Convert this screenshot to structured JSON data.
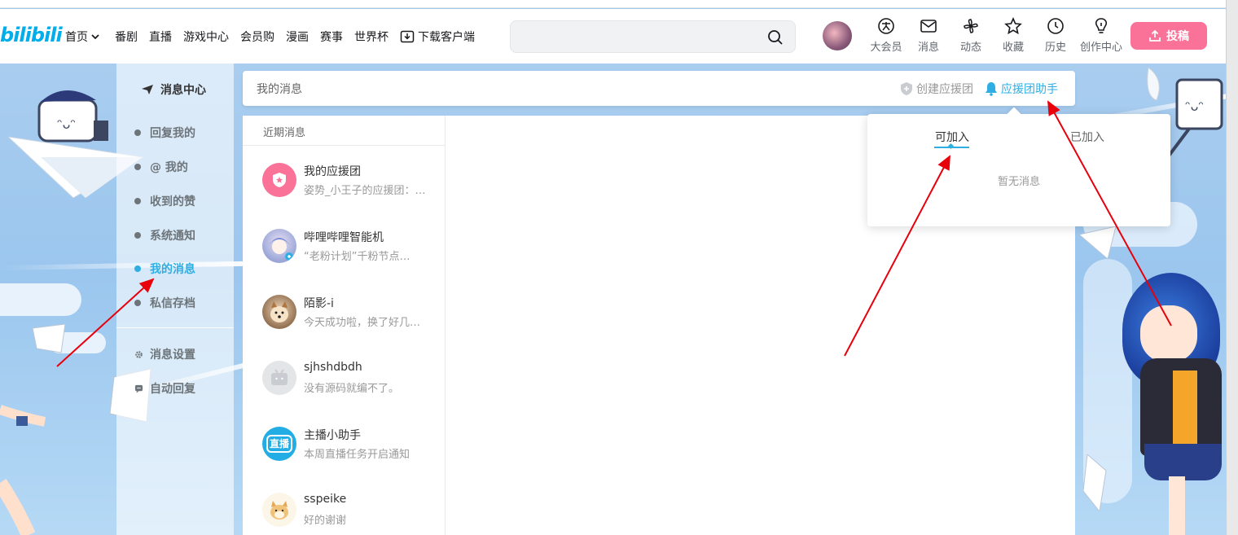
{
  "header": {
    "logo_text": "bilibili",
    "nav": [
      {
        "label": "首页"
      },
      {
        "label": "番剧"
      },
      {
        "label": "直播"
      },
      {
        "label": "游戏中心"
      },
      {
        "label": "会员购"
      },
      {
        "label": "漫画"
      },
      {
        "label": "赛事"
      },
      {
        "label": "世界杯"
      },
      {
        "label": "下载客户端"
      }
    ],
    "search_placeholder": "",
    "right_icons": [
      {
        "label": "大会员",
        "icon": "vip-icon"
      },
      {
        "label": "消息",
        "icon": "mail-icon"
      },
      {
        "label": "动态",
        "icon": "windmill-icon"
      },
      {
        "label": "收藏",
        "icon": "star-icon"
      },
      {
        "label": "历史",
        "icon": "clock-icon"
      },
      {
        "label": "创作中心",
        "icon": "bulb-icon"
      }
    ],
    "upload_label": "投稿"
  },
  "sidebar": {
    "title": "消息中心",
    "items": [
      {
        "label": "回复我的",
        "active": false
      },
      {
        "label": "@ 我的",
        "active": false
      },
      {
        "label": "收到的赞",
        "active": false
      },
      {
        "label": "系统通知",
        "active": false
      },
      {
        "label": "我的消息",
        "active": true
      },
      {
        "label": "私信存档",
        "active": false
      }
    ],
    "settings": [
      {
        "label": "消息设置",
        "icon": "gear-icon"
      },
      {
        "label": "自动回复",
        "icon": "chat-icon"
      }
    ]
  },
  "msgbar": {
    "title": "我的消息",
    "create_label": "创建应援团",
    "helper_label": "应援团助手"
  },
  "conversations": {
    "header": "近期消息",
    "items": [
      {
        "name": "我的应援团",
        "preview": "姿势_小王子的应援团：…",
        "avatar": "badge"
      },
      {
        "name": "哔哩哔哩智能机",
        "preview": "“老粉计划”千粉节点…",
        "avatar": "anime"
      },
      {
        "name": "陌影-i",
        "preview": "今天成功啦，换了好几…",
        "avatar": "dog"
      },
      {
        "name": "sjhshdbdh",
        "preview": "没有源码就编不了。",
        "avatar": "default"
      },
      {
        "name": "主播小助手",
        "preview": "本周直播任务开启通知",
        "avatar": "live"
      },
      {
        "name": "sspeike",
        "preview": "好的谢谢",
        "avatar": "shiba"
      }
    ]
  },
  "dropdown": {
    "tabs": [
      "可加入",
      "已加入"
    ],
    "active_tab": "可加入",
    "empty_text": "暂无消息",
    "live_avatar_text": "直播"
  },
  "colors": {
    "accent": "#2faee3",
    "brand_pink": "#fb7299",
    "annotation_arrow": "#e8000b"
  }
}
